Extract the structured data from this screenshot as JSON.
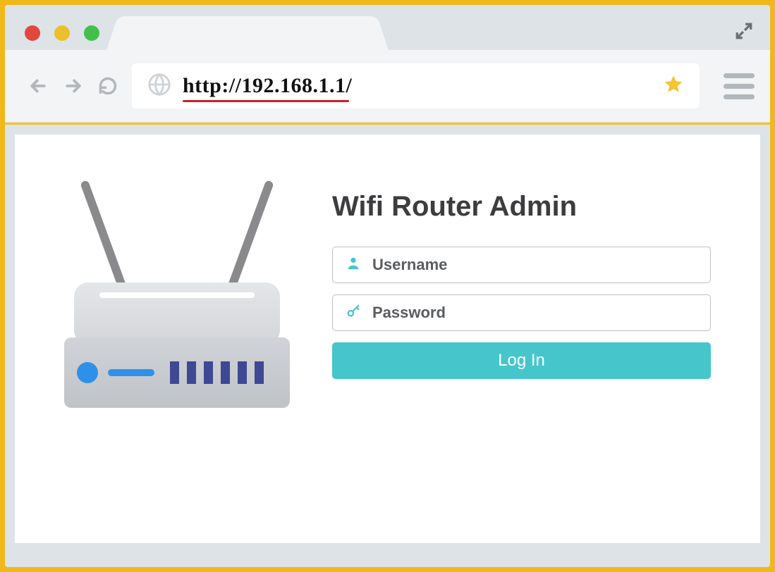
{
  "browser": {
    "url": "http://192.168.1.1/",
    "colors": {
      "star": "#f4c431",
      "underline": "#cc2027"
    }
  },
  "page": {
    "title": "Wifi Router Admin",
    "username": {
      "placeholder": "Username",
      "value": ""
    },
    "password": {
      "placeholder": "Password",
      "value": ""
    },
    "login_label": "Log In"
  }
}
